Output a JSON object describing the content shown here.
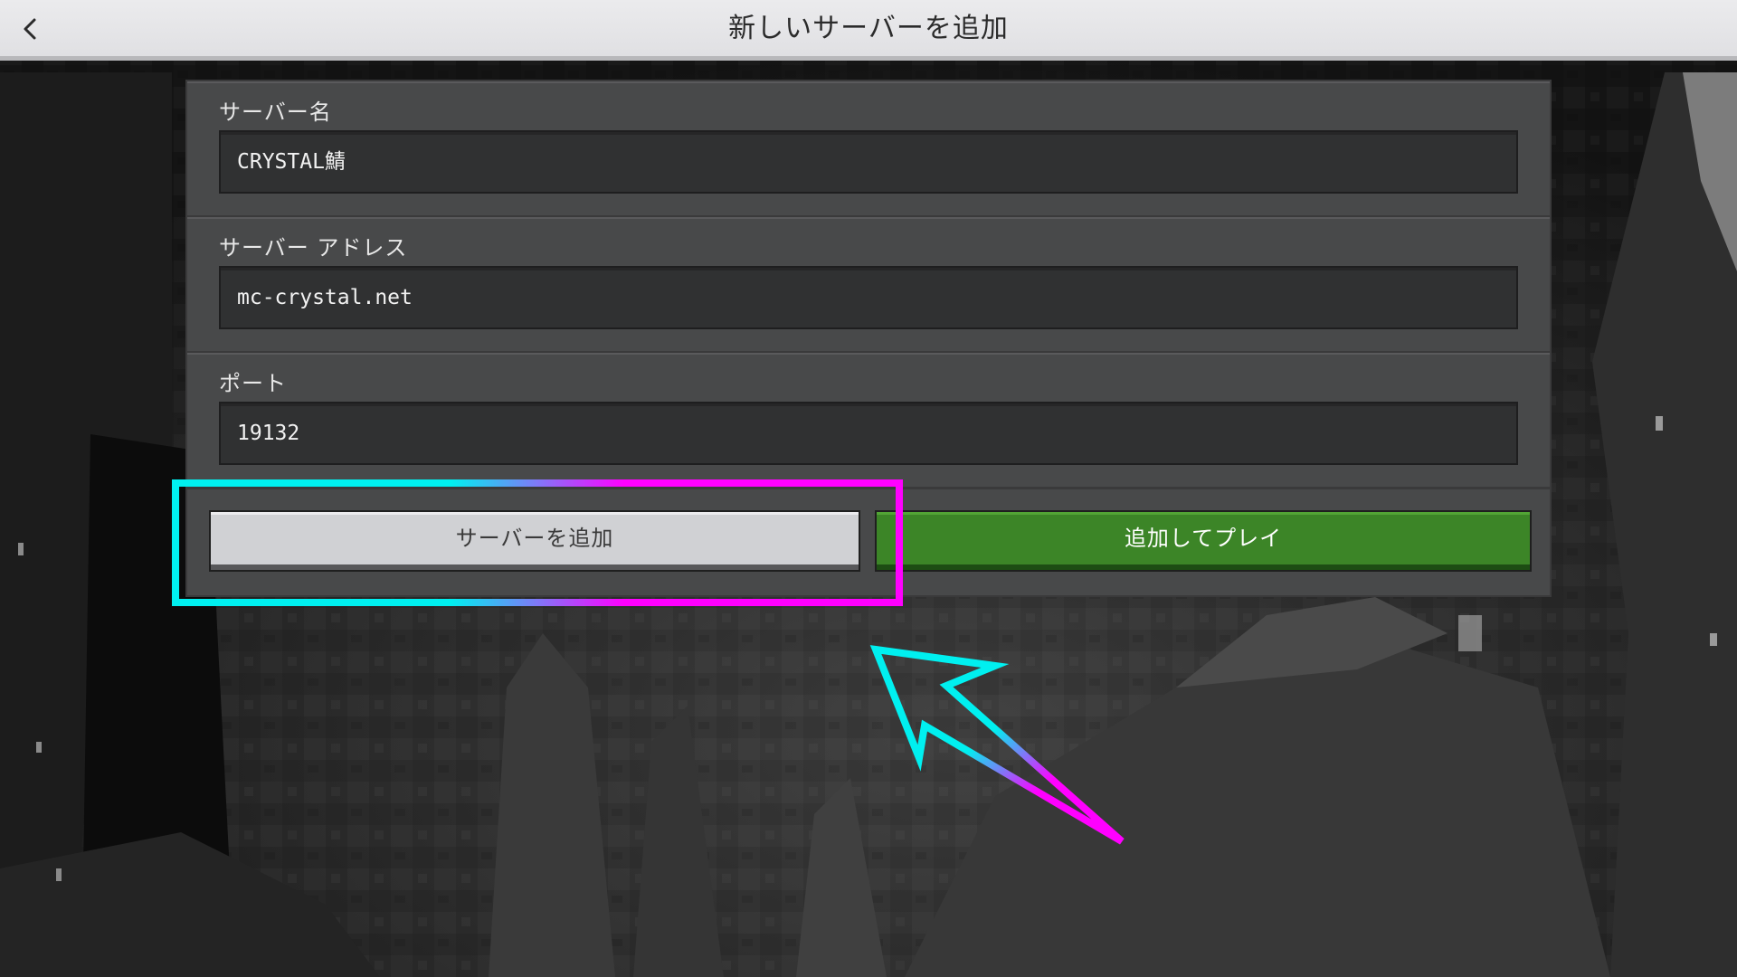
{
  "header": {
    "title": "新しいサーバーを追加",
    "back_icon": "chevron-left-icon"
  },
  "form": {
    "server_name": {
      "label": "サーバー名",
      "value": "CRYSTAL鯖"
    },
    "server_address": {
      "label": "サーバー アドレス",
      "value": "mc-crystal.net"
    },
    "port": {
      "label": "ポート",
      "value": "19132"
    }
  },
  "buttons": {
    "add_server": "サーバーを追加",
    "add_and_play": "追加してプレイ"
  },
  "annotation": {
    "highlight_colors": [
      "#00f0f0",
      "#ff00ff"
    ],
    "arrow_icon": "arrow-pointer-icon"
  },
  "colors": {
    "title_bar": "#e4e4e7",
    "panel": "#48494a",
    "field": "#303132",
    "primary_button": "#3c8527",
    "secondary_button": "#d0d1d4"
  }
}
